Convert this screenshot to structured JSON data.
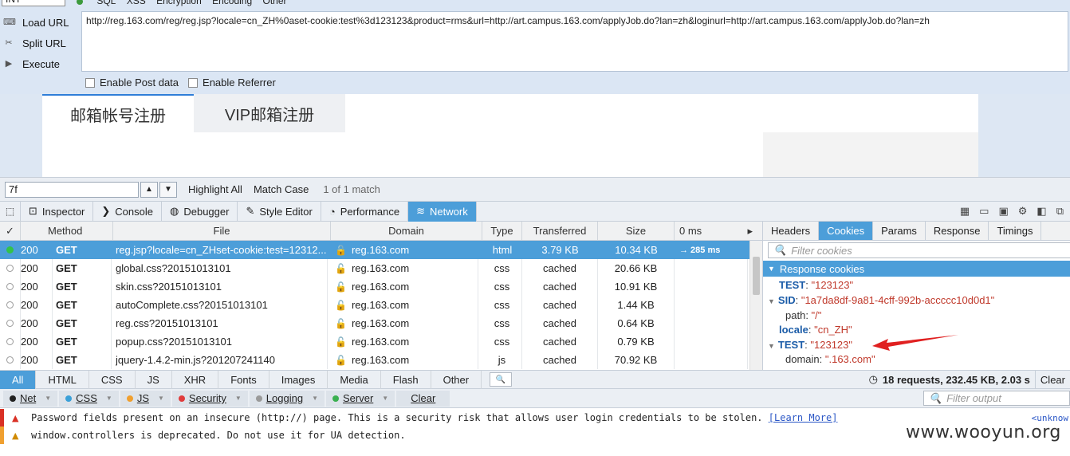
{
  "hackbar": {
    "type_combo": "INT",
    "menu": [
      "SQL",
      "XSS",
      "Encryption",
      "Encoding",
      "Other"
    ],
    "load_url": "Load URL",
    "split_url": "Split URL",
    "execute": "Execute",
    "url": "http://reg.163.com/reg/reg.jsp?locale=cn_ZH%0aset-cookie:test%3d123123&product=rms&url=http://art.campus.163.com/applyJob.do?lan=zh&loginurl=http://art.campus.163.com/applyJob.do?lan=zh",
    "enable_post": "Enable Post data",
    "enable_referrer": "Enable Referrer"
  },
  "page": {
    "tab1": "邮箱帐号注册",
    "tab2": "VIP邮箱注册"
  },
  "findbar": {
    "query": "7f",
    "highlight_all": "Highlight All",
    "match_case": "Match Case",
    "match_count": "1 of 1 match"
  },
  "devtools": {
    "tabs": [
      "Inspector",
      "Console",
      "Debugger",
      "Style Editor",
      "Performance",
      "Network"
    ],
    "active_tab": "Network"
  },
  "network": {
    "headers": {
      "check": "✓",
      "method": "Method",
      "file": "File",
      "domain": "Domain",
      "type": "Type",
      "transferred": "Transferred",
      "size": "Size",
      "timeline": "0 ms"
    },
    "rows": [
      {
        "status": "200",
        "method": "GET",
        "file": "reg.jsp?locale=cn_ZHset-cookie:test=12312...",
        "domain": "reg.163.com",
        "type": "html",
        "transferred": "3.79 KB",
        "size": "10.34 KB",
        "timing": "→ 285 ms"
      },
      {
        "status": "200",
        "method": "GET",
        "file": "global.css?20151013101",
        "domain": "reg.163.com",
        "type": "css",
        "transferred": "cached",
        "size": "20.66 KB",
        "timing": ""
      },
      {
        "status": "200",
        "method": "GET",
        "file": "skin.css?20151013101",
        "domain": "reg.163.com",
        "type": "css",
        "transferred": "cached",
        "size": "10.91 KB",
        "timing": ""
      },
      {
        "status": "200",
        "method": "GET",
        "file": "autoComplete.css?20151013101",
        "domain": "reg.163.com",
        "type": "css",
        "transferred": "cached",
        "size": "1.44 KB",
        "timing": ""
      },
      {
        "status": "200",
        "method": "GET",
        "file": "reg.css?20151013101",
        "domain": "reg.163.com",
        "type": "css",
        "transferred": "cached",
        "size": "0.64 KB",
        "timing": ""
      },
      {
        "status": "200",
        "method": "GET",
        "file": "popup.css?20151013101",
        "domain": "reg.163.com",
        "type": "css",
        "transferred": "cached",
        "size": "0.79 KB",
        "timing": ""
      },
      {
        "status": "200",
        "method": "GET",
        "file": "jquery-1.4.2-min.js?201207241140",
        "domain": "reg.163.com",
        "type": "js",
        "transferred": "cached",
        "size": "70.92 KB",
        "timing": ""
      }
    ]
  },
  "sidepanel": {
    "tabs": [
      "Headers",
      "Cookies",
      "Params",
      "Response",
      "Timings"
    ],
    "active_tab": "Cookies",
    "filter_placeholder": "Filter cookies",
    "section": "Response cookies",
    "cookies": [
      {
        "key": "TEST",
        "value": "\"123123\""
      },
      {
        "key": "SID",
        "value": "\"1a7da8df-9a81-4cff-992b-accccc10d0d1\""
      },
      {
        "key": "path",
        "value": "\"/\""
      },
      {
        "key": "locale",
        "value": "\"cn_ZH\""
      },
      {
        "key": "TEST",
        "value": "\"123123\""
      },
      {
        "key": "domain",
        "value": "\".163.com\""
      }
    ]
  },
  "filterbar": {
    "items": [
      "All",
      "HTML",
      "CSS",
      "JS",
      "XHR",
      "Fonts",
      "Images",
      "Media",
      "Flash",
      "Other"
    ],
    "active": "All",
    "summary": "18 requests, 232.45 KB, 2.03 s",
    "clear": "Clear"
  },
  "console": {
    "filters": [
      {
        "label": "Net",
        "color": "#222222"
      },
      {
        "label": "CSS",
        "color": "#3aa0d8"
      },
      {
        "label": "JS",
        "color": "#f0a030"
      },
      {
        "label": "Security",
        "color": "#e03c3c"
      },
      {
        "label": "Logging",
        "color": "#9a9a9a"
      },
      {
        "label": "Server",
        "color": "#3ab050"
      }
    ],
    "clear": "Clear",
    "filter_placeholder": "Filter output",
    "messages": [
      {
        "text": "Password fields present on an insecure (http://) page. This is a security risk that allows user login credentials to be stolen.",
        "link": "[Learn More]",
        "source": "<unknow",
        "bar_color": "#d93025"
      },
      {
        "text": "window.controllers is deprecated. Do not use it for UA detection.",
        "link": "",
        "source": "",
        "bar_color": "#f0a030"
      }
    ]
  },
  "watermark": "www.wooyun.org"
}
